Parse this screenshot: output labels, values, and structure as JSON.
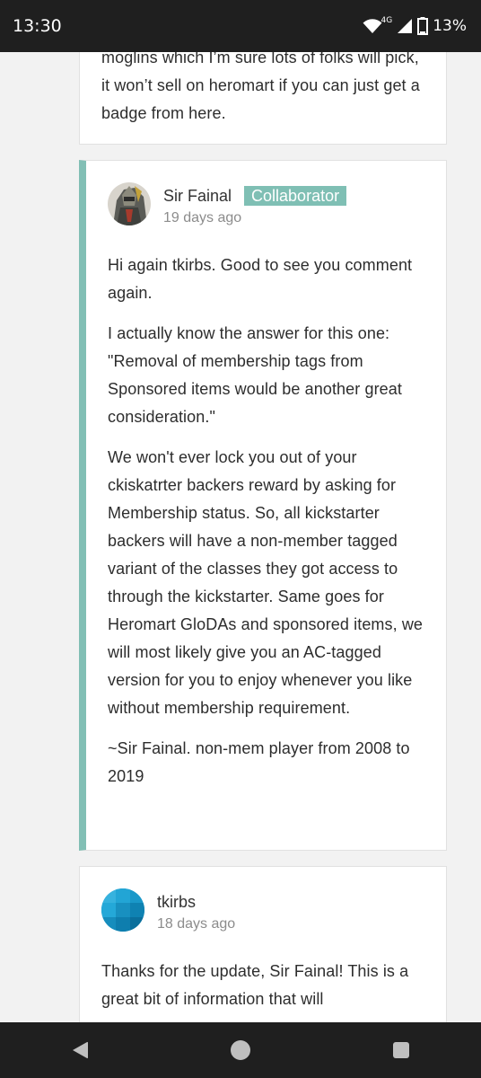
{
  "status_bar": {
    "time": "13:30",
    "network": "4G",
    "battery": "13%"
  },
  "comments": [
    {
      "body": [
        "moglins which I’m sure lots of folks will pick, it won’t sell on heromart if you can just get a badge from here."
      ]
    },
    {
      "author": "Sir Fainal",
      "badge": "Collaborator",
      "time": "19 days ago",
      "body": [
        "Hi again tkirbs. Good to see you comment again.",
        "I actually know the answer for this one: \"Removal of membership tags from Sponsored items would be another great consideration.\"",
        "We won't ever lock you out of your ckiskatrter backers reward by asking for Membership status. So, all kickstarter backers will have a non-member tagged variant of the classes they got access to through the kickstarter. Same goes for Heromart GloDAs and sponsored items, we will most likely give you an AC-tagged version for you to enjoy whenever you like without membership requirement.",
        "~Sir Fainal. non-mem player from 2008 to 2019"
      ]
    },
    {
      "author": "tkirbs",
      "time": "18 days ago",
      "body": [
        "Thanks for the update, Sir Fainal! This is a great bit of information that will"
      ]
    }
  ],
  "colors": {
    "accent": "#82bfb5",
    "badge_bg": "#7fbfb4",
    "status_bar": "#1f1f1f"
  },
  "icons": {
    "wifi": "wifi-icon",
    "signal": "signal-icon",
    "battery": "battery-icon",
    "back": "back-icon",
    "home": "home-icon",
    "recents": "recents-icon"
  }
}
